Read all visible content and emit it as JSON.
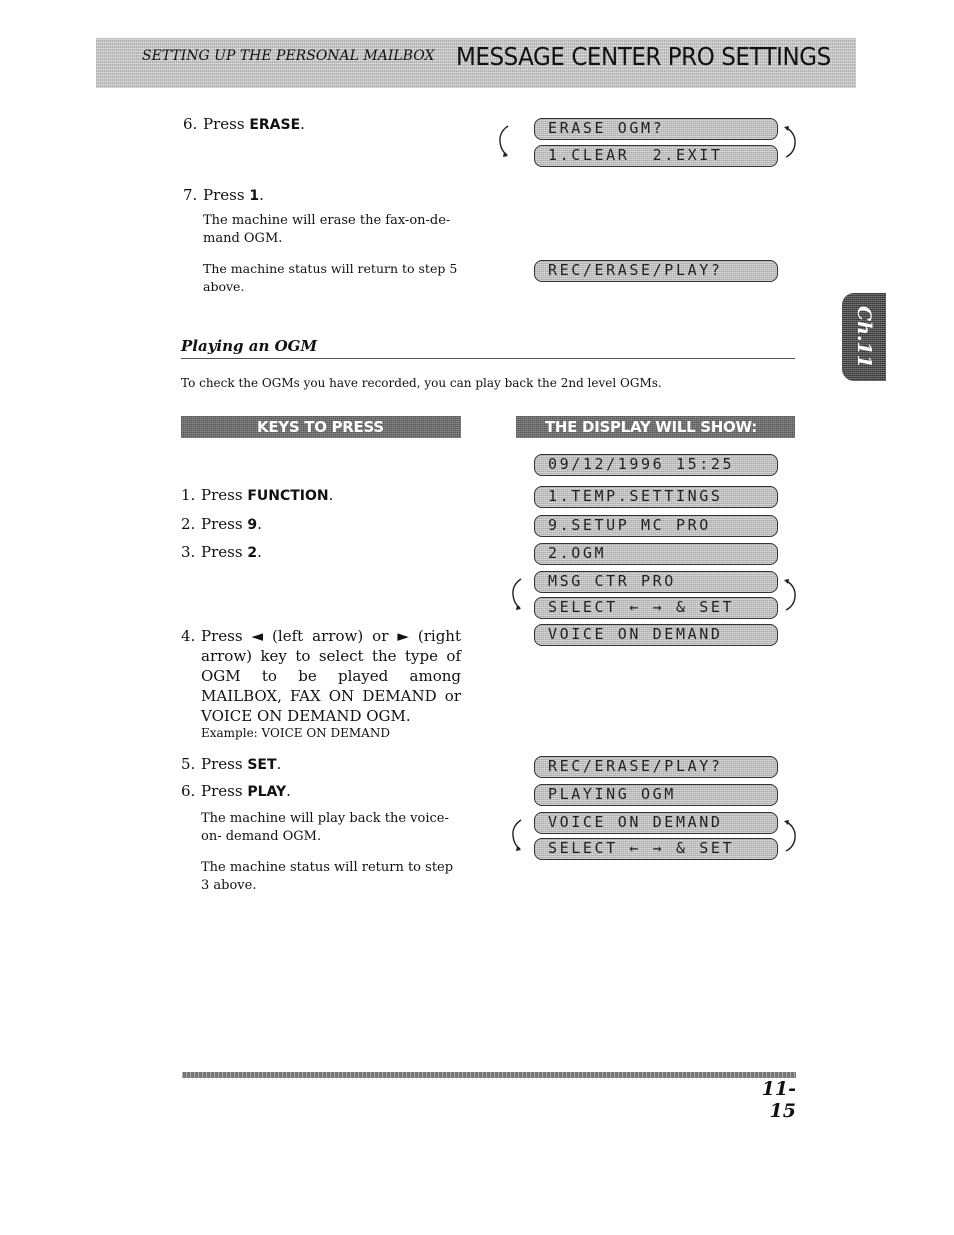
{
  "header": {
    "section": "SETTING UP THE PERSONAL MAILBOX",
    "title": "MESSAGE CENTER PRO SETTINGS"
  },
  "chapter_tab": "Ch.11",
  "erase_section": {
    "steps": [
      {
        "num": "6.",
        "prefix": "Press ",
        "key": "ERASE",
        "suffix": "."
      },
      {
        "num": "7.",
        "prefix": "Press ",
        "key": "1",
        "suffix": "."
      }
    ],
    "notes": [
      "The machine will erase the fax-on-de- mand OGM.",
      "The machine status will return to step 5 above."
    ],
    "display": {
      "alternating": [
        "ERASE OGM?",
        "1.CLEAR  2.EXIT"
      ],
      "status": "REC/ERASE/PLAY?"
    }
  },
  "playing_section": {
    "heading": "Playing an OGM",
    "intro": "To check the OGMs you have recorded, you can play back the 2nd level OGMs.",
    "keys_banner": "KEYS TO PRESS",
    "display_banner": "THE DISPLAY WILL SHOW:",
    "steps": [
      {
        "num": "1.",
        "prefix": "Press ",
        "key": "FUNCTION",
        "suffix": "."
      },
      {
        "num": "2.",
        "prefix": "Press ",
        "key": "9",
        "suffix": "."
      },
      {
        "num": "3.",
        "prefix": "Press ",
        "key": "2",
        "suffix": "."
      },
      {
        "num": "4.",
        "text": "Press ◄ (left arrow) or ► (right arrow) key to select the type of OGM to be played among MAILBOX, FAX ON DEMAND or VOICE ON DEMAND OGM."
      },
      {
        "num": "5.",
        "prefix": "Press ",
        "key": "SET",
        "suffix": "."
      },
      {
        "num": "6.",
        "prefix": "Press ",
        "key": "PLAY",
        "suffix": "."
      }
    ],
    "example": "Example: VOICE ON DEMAND",
    "notes": [
      "The machine will play back the voice-on- demand OGM.",
      "The machine status will return to step 3 above."
    ],
    "displays": {
      "date_time": "09/12/1996 15:25",
      "menu_1": "1.TEMP.SETTINGS",
      "menu_9": "9.SETUP MC PRO",
      "menu_2": "2.OGM",
      "alt_a": [
        "MSG CTR PRO",
        "SELECT ← → & SET"
      ],
      "selection": "VOICE ON DEMAND",
      "after_set": "REC/ERASE/PLAY?",
      "playing": "PLAYING OGM",
      "alt_b": [
        "VOICE ON DEMAND",
        "SELECT ← → & SET"
      ]
    }
  },
  "footer": {
    "page_number": "11-15"
  }
}
